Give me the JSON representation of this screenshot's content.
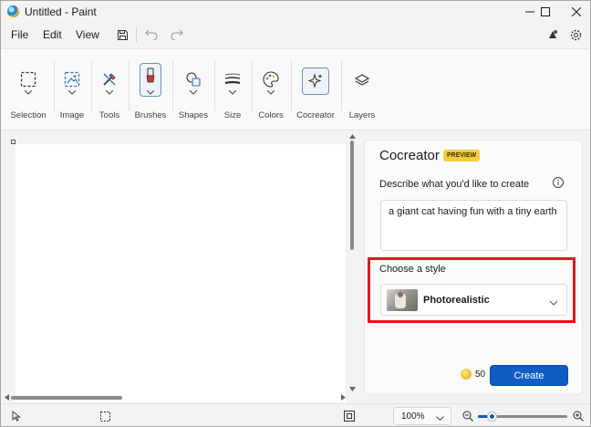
{
  "window": {
    "title": "Untitled - Paint"
  },
  "menu": {
    "file": "File",
    "edit": "Edit",
    "view": "View"
  },
  "ribbon": {
    "groups": [
      {
        "label": "Selection",
        "icon": "selection-icon"
      },
      {
        "label": "Image",
        "icon": "image-icon"
      },
      {
        "label": "Tools",
        "icon": "tools-icon"
      },
      {
        "label": "Brushes",
        "icon": "brush-icon"
      },
      {
        "label": "Shapes",
        "icon": "shapes-icon"
      },
      {
        "label": "Size",
        "icon": "size-icon"
      },
      {
        "label": "Colors",
        "icon": "palette-icon"
      },
      {
        "label": "Cocreator",
        "icon": "cocreator-icon"
      },
      {
        "label": "Layers",
        "icon": "layers-icon"
      }
    ]
  },
  "cocreator": {
    "title": "Cocreator",
    "badge": "PREVIEW",
    "describe_label": "Describe what you'd like to create",
    "prompt": "a giant cat having fun with a tiny earth",
    "style_label": "Choose a style",
    "style_value": "Photorealistic",
    "credits": "50",
    "create_label": "Create",
    "accent_color": "#0f5cc4",
    "highlight_color": "#e3141c"
  },
  "statusbar": {
    "zoom": "100%",
    "zoom_level": 0.15
  }
}
